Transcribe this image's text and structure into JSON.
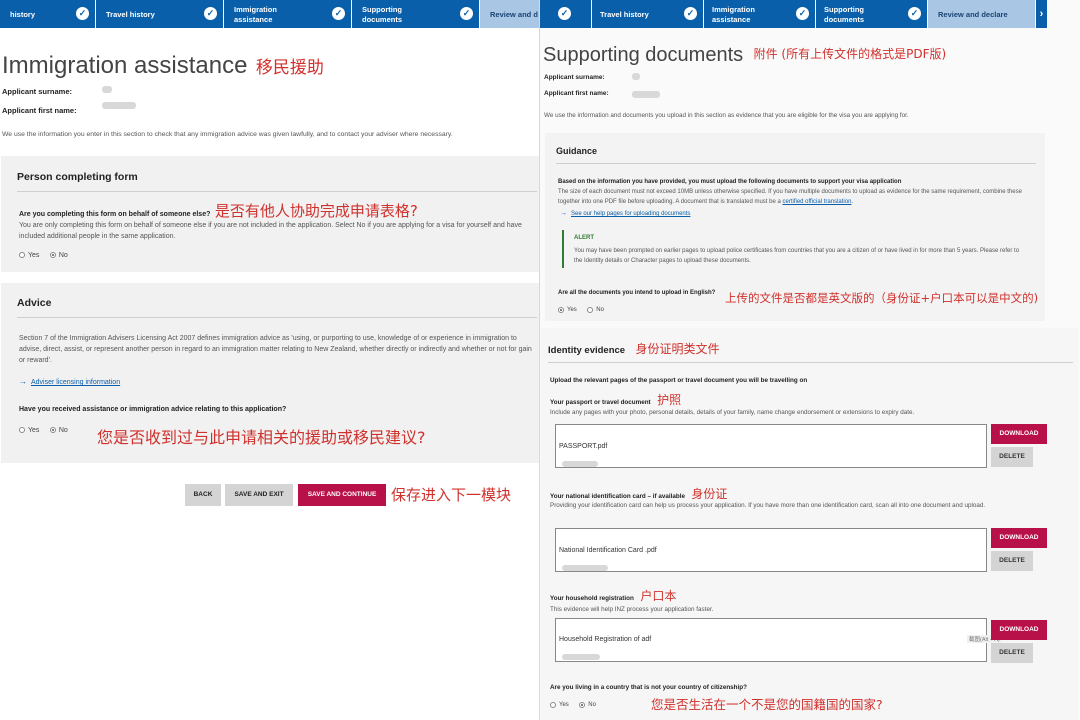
{
  "left": {
    "steps": [
      {
        "label": "history"
      },
      {
        "label": "Travel history"
      },
      {
        "label": "Immigration assistance"
      },
      {
        "label": "Supporting documents"
      },
      {
        "label": "Review and d"
      }
    ],
    "title": "Immigration assistance",
    "title_annot": "移民援助",
    "surname_label": "Applicant surname:",
    "firstname_label": "Applicant first name:",
    "intro": "We use the information you enter in this section to check that any immigration advice was given lawfully, and to contact your adviser where necessary.",
    "person": {
      "heading": "Person completing form",
      "question": "Are you completing this form on behalf of someone else?",
      "question_annot": "是否有他人协助完成申请表格?",
      "help": "You are only completing this form on behalf of someone else if you are not included in the application. Select No if you are applying for a visa for yourself and have included additional people in the same application.",
      "yes": "Yes",
      "no": "No"
    },
    "advice": {
      "heading": "Advice",
      "body": "Section 7 of the Immigration Advisers Licensing Act 2007 defines immigration advice as 'using, or purporting to use, knowledge of or experience in immigration to advise, direct, assist, or represent another person in regard to an immigration matter relating to New Zealand, whether directly or indirectly and whether or not for gain or reward'.",
      "link": "Adviser licensing information",
      "question": "Have you received assistance or immigration advice relating to this application?",
      "yes": "Yes",
      "no": "No",
      "annot": "您是否收到过与此申请相关的援助或移民建议?"
    },
    "buttons": {
      "back": "BACK",
      "save_exit": "SAVE AND EXIT",
      "save_continue": "SAVE AND CONTINUE"
    },
    "buttons_annot": "保存进入下一模块"
  },
  "right": {
    "steps": [
      {
        "label": "Travel history"
      },
      {
        "label": "Immigration assistance"
      },
      {
        "label": "Supporting documents"
      },
      {
        "label": "Review and declare"
      }
    ],
    "title": "Supporting documents",
    "title_annot": "附件 (所有上传文件的格式是PDF版)",
    "surname_label": "Applicant surname:",
    "firstname_label": "Applicant first name:",
    "intro": "We use the information and documents you upload in this section as evidence that you are eligible for the visa you are applying for.",
    "guidance": {
      "heading": "Guidance",
      "lead": "Based on the information you have provided, you must upload the following documents to support your visa application",
      "body_before_link": "The size of each document must not exceed 10MB unless otherwise specified. If you have multiple documents to upload as evidence for the same requirement, combine these together into one PDF file before uploading. A document that is translated must be a ",
      "cert_link": "certified official translation",
      "help_link": "See our help pages for uploading documents",
      "alert_title": "ALERT",
      "alert_body": "You may have been prompted on earlier pages to upload police certificates from countries that you are a citizen of or have lived in for more than 5 years. Please refer to the Identity details or Character pages to upload these documents.",
      "english_q": "Are all the documents you intend to upload in English?",
      "yes": "Yes",
      "no": "No",
      "english_annot": "上传的文件是否都是英文版的（身份证+户口本可以是中文的)"
    },
    "identity": {
      "heading": "Identity evidence",
      "heading_annot": "身份证明类文件",
      "upload_instr": "Upload the relevant pages of the passport or travel document you will be travelling on",
      "passport_label": "Your passport or travel document",
      "passport_annot": "护照",
      "passport_help": "Include any pages with your photo, personal details, details of your family, name change endorsement or extensions to expiry date.",
      "passport_file": "PASSPORT.pdf",
      "national_label": "Your national identification card – if available",
      "national_annot": "身份证",
      "national_help": "Providing your identification card can help us process your application. If you have more than one identification card, scan all into one document and upload.",
      "national_file_prefix": "National Identification Card",
      "national_file_suffix": ".pdf",
      "household_label": "Your household registration",
      "household_annot": "户口本",
      "household_help": "This evidence will help INZ process your application faster.",
      "household_file_prefix": "Household Registration of",
      "household_file_suffix": "adf",
      "download": "DOWNLOAD",
      "delete": "DELETE",
      "screenshot_tip": "截图(Alt + A)",
      "country_q": "Are you living in a country that is not your country of citizenship?",
      "yes": "Yes",
      "no": "No",
      "country_annot": "您是否生活在一个不是您的国籍国的国家?"
    }
  }
}
